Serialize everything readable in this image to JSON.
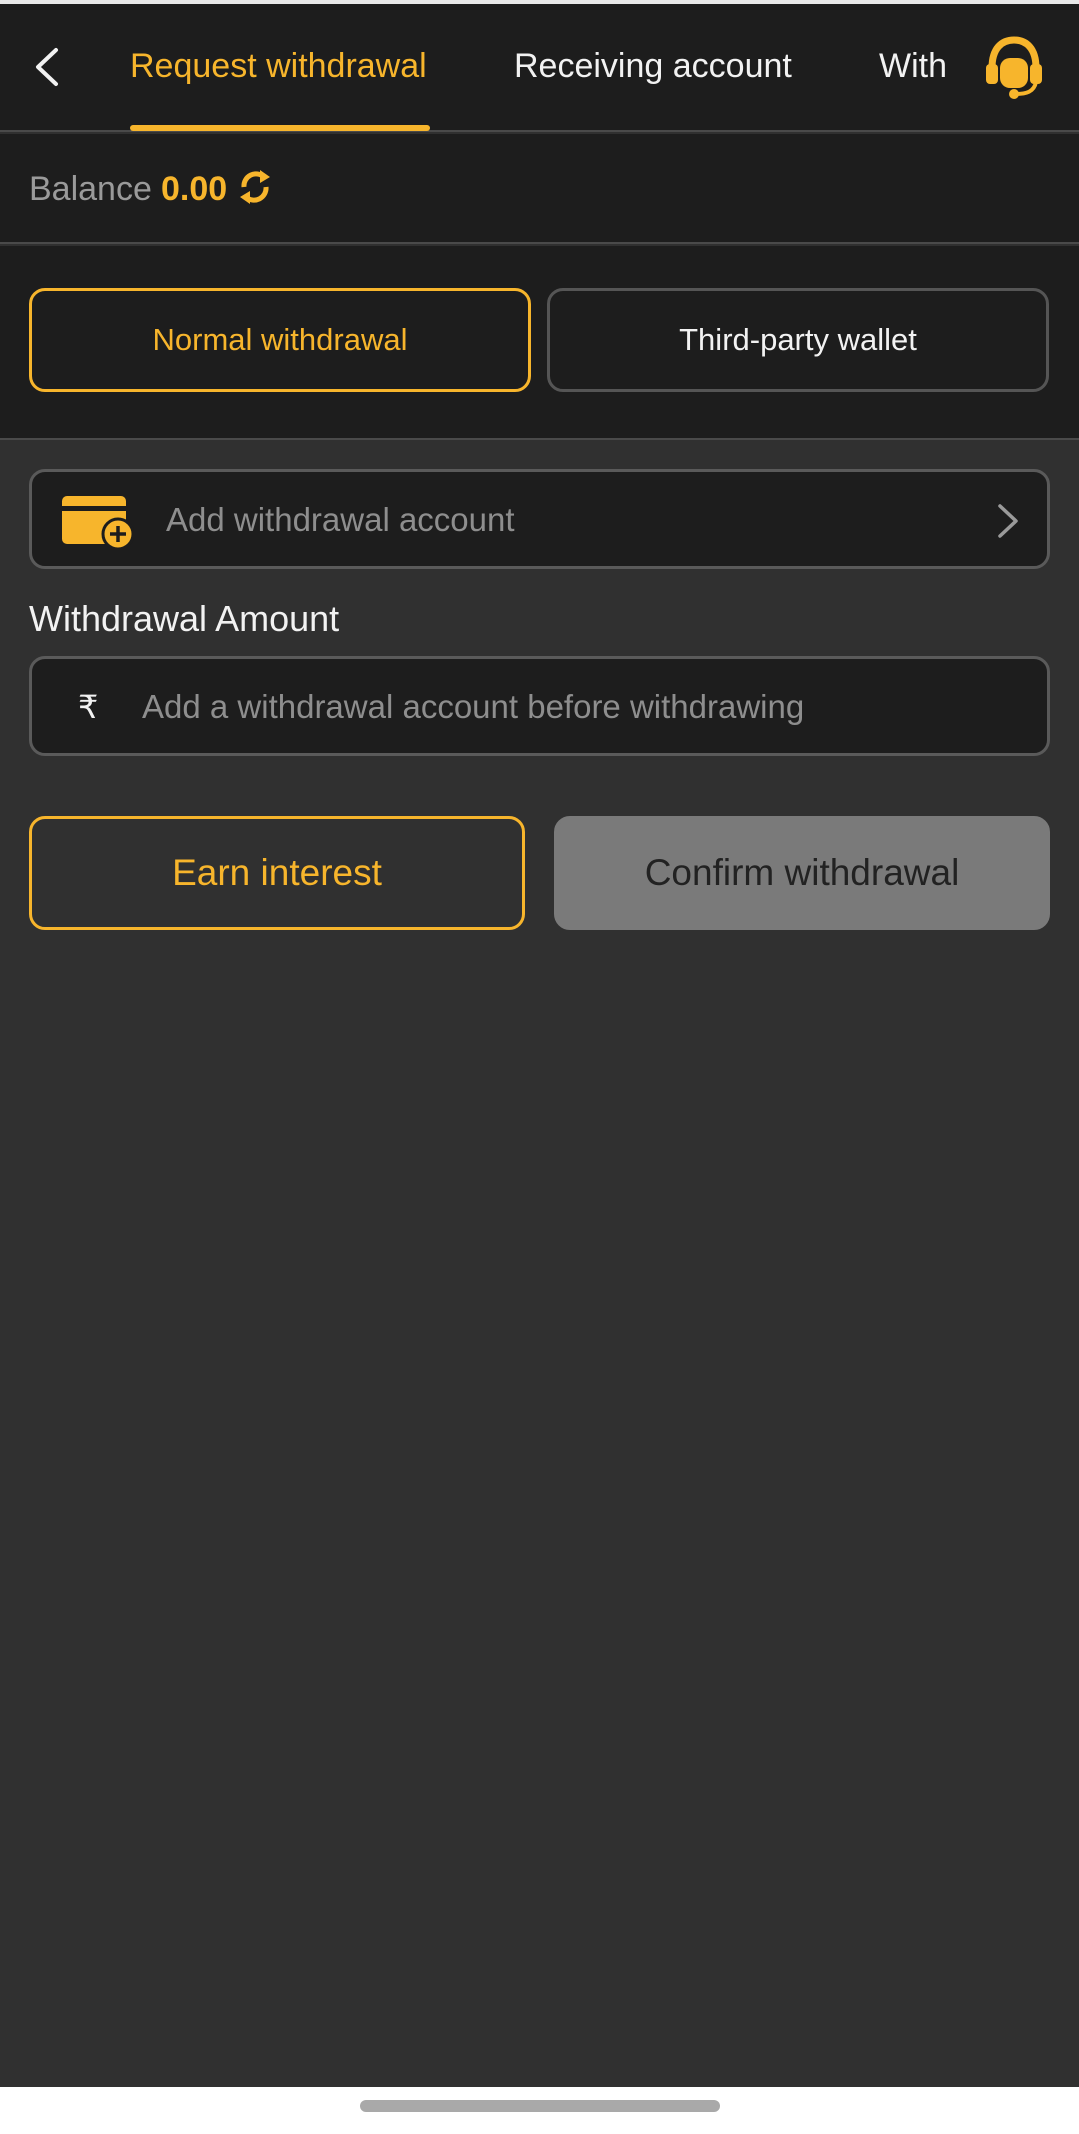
{
  "header": {
    "tabs": [
      {
        "label": "Request withdrawal",
        "active": true
      },
      {
        "label": "Receiving account",
        "active": false
      },
      {
        "label": "With",
        "active": false
      }
    ],
    "back_icon": "chevron-left-icon",
    "support_icon": "headset-icon"
  },
  "balance": {
    "label": "Balance",
    "value": "0.00",
    "refresh_icon": "refresh-icon"
  },
  "withdrawal_types": {
    "normal": "Normal withdrawal",
    "third_party": "Third-party wallet",
    "selected": "normal"
  },
  "account": {
    "add_label": "Add withdrawal account",
    "wallet_icon": "wallet-add-icon"
  },
  "amount": {
    "title": "Withdrawal Amount",
    "currency_symbol": "₹",
    "placeholder": "Add a withdrawal account before withdrawing"
  },
  "actions": {
    "earn_label": "Earn interest",
    "confirm_label": "Confirm withdrawal"
  },
  "colors": {
    "accent": "#f7b52c",
    "background": "#303030",
    "panel": "#1d1d1d",
    "disabled_button": "#7a7a7a"
  }
}
